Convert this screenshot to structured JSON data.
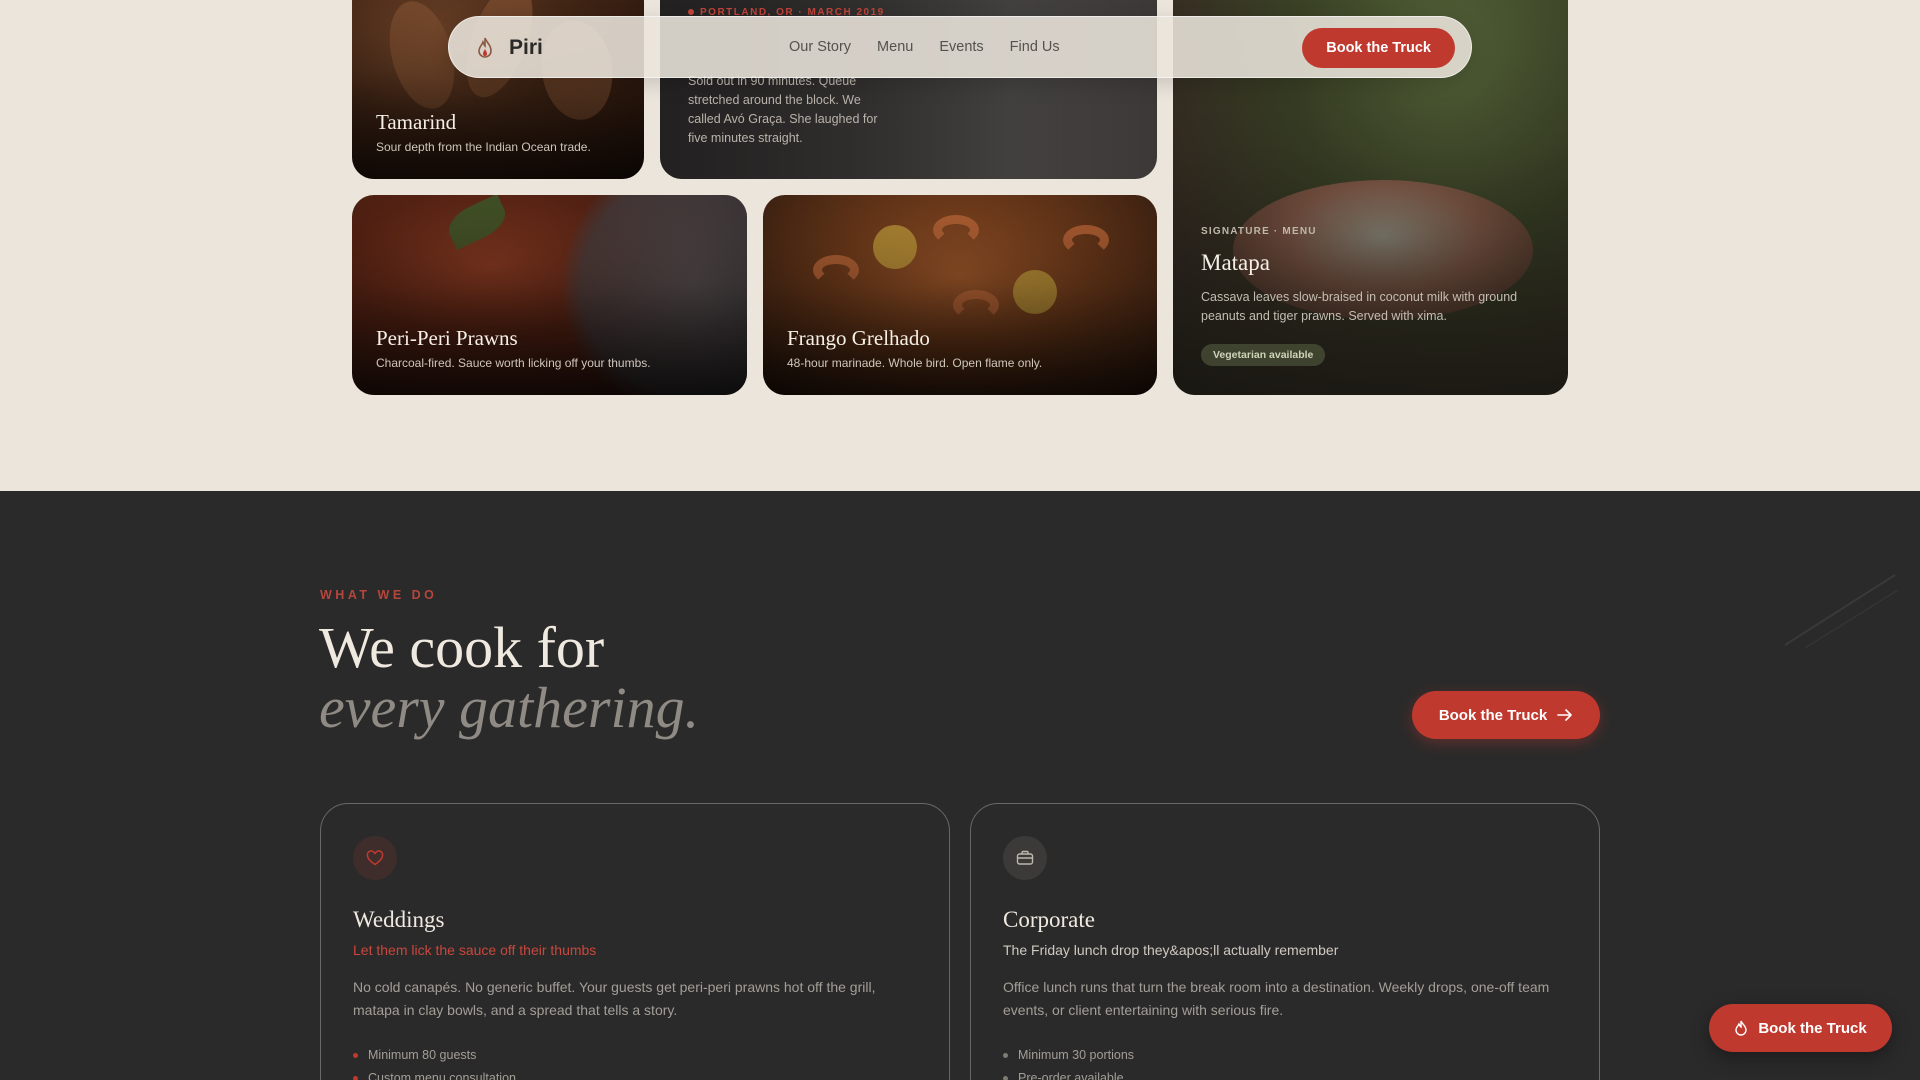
{
  "nav": {
    "brand": "Piri",
    "links": [
      "Our Story",
      "Menu",
      "Events",
      "Find Us"
    ],
    "cta": "Book the Truck"
  },
  "gallery": {
    "tamarind": {
      "title": "Tamarind",
      "desc": "Sour depth from the Indian Ocean trade."
    },
    "story": {
      "location": "PORTLAND, OR · MARCH 2019",
      "text": "Sold out in 90 minutes. Queue stretched around the block. We called Avó Graça. She laughed for five minutes straight."
    },
    "matapa": {
      "label": "SIGNATURE · MENU",
      "title": "Matapa",
      "desc": "Cassava leaves slow-braised in coconut milk with ground peanuts and tiger prawns. Served with xima.",
      "badge": "Vegetarian available"
    },
    "prawns": {
      "title": "Peri-Peri Prawns",
      "desc": "Charcoal-fired. Sauce worth licking off your thumbs."
    },
    "frango": {
      "title": "Frango Grelhado",
      "desc": "48-hour marinade. Whole bird. Open flame only."
    }
  },
  "services": {
    "eyebrow": "WHAT WE DO",
    "headline_1": "We cook for",
    "headline_2": "every gathering.",
    "cta": "Book the Truck",
    "weddings": {
      "icon": "heart-icon",
      "title": "Weddings",
      "subtitle": "Let them lick the sauce off their thumbs",
      "desc": "No cold canapés. No generic buffet. Your guests get peri-peri prawns hot off the grill, matapa in clay bowls, and a spread that tells a story.",
      "items": [
        "Minimum 80 guests",
        "Custom menu consultation"
      ]
    },
    "corporate": {
      "icon": "briefcase-icon",
      "title": "Corporate",
      "subtitle": "The Friday lunch drop they&apos;ll actually remember",
      "desc": "Office lunch runs that turn the break room into a destination. Weekly drops, one-off team events, or client entertaining with serious fire.",
      "items": [
        "Minimum 30 portions",
        "Pre-order available"
      ]
    }
  },
  "floating_cta": {
    "label": "Book the Truck",
    "icon": "flame-icon"
  },
  "colors": {
    "accent": "#c0392e",
    "cream": "#ebe5dc",
    "dark": "#2b2a2a"
  }
}
